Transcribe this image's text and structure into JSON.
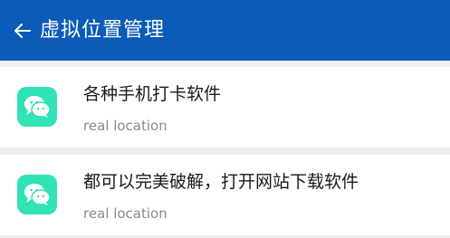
{
  "header": {
    "title": "虚拟位置管理",
    "back_icon": "arrow-left-icon",
    "background": "#0b5bb8"
  },
  "items": [
    {
      "title": "各种手机打卡软件",
      "subtitle": "real location",
      "icon": "wechat-icon",
      "icon_color": "#30e3b6"
    },
    {
      "title": "都可以完美破解，打开网站下载软件",
      "subtitle": "real location",
      "icon": "wechat-icon",
      "icon_color": "#30e3b6"
    }
  ]
}
